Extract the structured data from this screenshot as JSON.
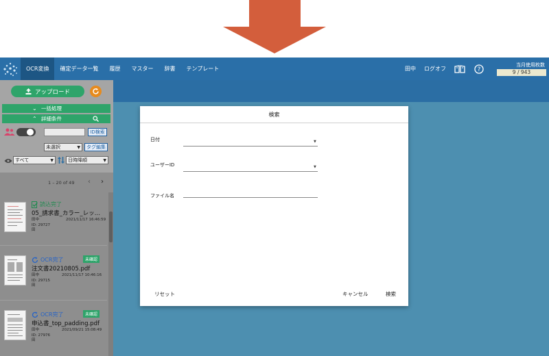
{
  "colors": {
    "arrow": "#d35e3c",
    "nav": "#2a6fa8",
    "accent_green": "#2ea46a",
    "refresh": "#e78b1e"
  },
  "nav": {
    "items": [
      "OCR変換",
      "確定データ一覧",
      "履歴",
      "マスター",
      "辞書",
      "テンプレート"
    ],
    "user": "田中",
    "logout": "ログオフ",
    "usage_label": "当月使用枚数",
    "usage_value": "9 / 943"
  },
  "sidebar": {
    "upload": "アップロード",
    "bulk": "一括処理",
    "detail": "詳細条件",
    "id_search": "ID検索",
    "unselected": "未選択",
    "tag_edit": "タグ編集",
    "filter_all": "すべて",
    "sort": "日時降順",
    "pager": "1 – 20 of 49"
  },
  "documents": [
    {
      "status": "読込完了",
      "badge": "",
      "name": "05_請求書_カラー_レッ…",
      "user": "田中",
      "id": "ID: 29727",
      "extra": "田",
      "date": "2021/11/17 16:46:59"
    },
    {
      "status": "OCR完了",
      "badge": "未確認",
      "name": "注文書20210805.pdf",
      "user": "田中",
      "id": "ID: 29715",
      "extra": "田",
      "date": "2021/11/17 10:46:16"
    },
    {
      "status": "OCR完了",
      "badge": "未確認",
      "name": "申込書_top_padding.pdf",
      "user": "田中",
      "id": "ID: 27976",
      "extra": "田",
      "date": "2021/09/21 15:08:49"
    }
  ],
  "modal": {
    "title": "検索",
    "date_label": "日付",
    "user_label": "ユーザーID",
    "file_label": "ファイル名",
    "reset": "リセット",
    "cancel": "キャンセル",
    "search": "検索"
  }
}
